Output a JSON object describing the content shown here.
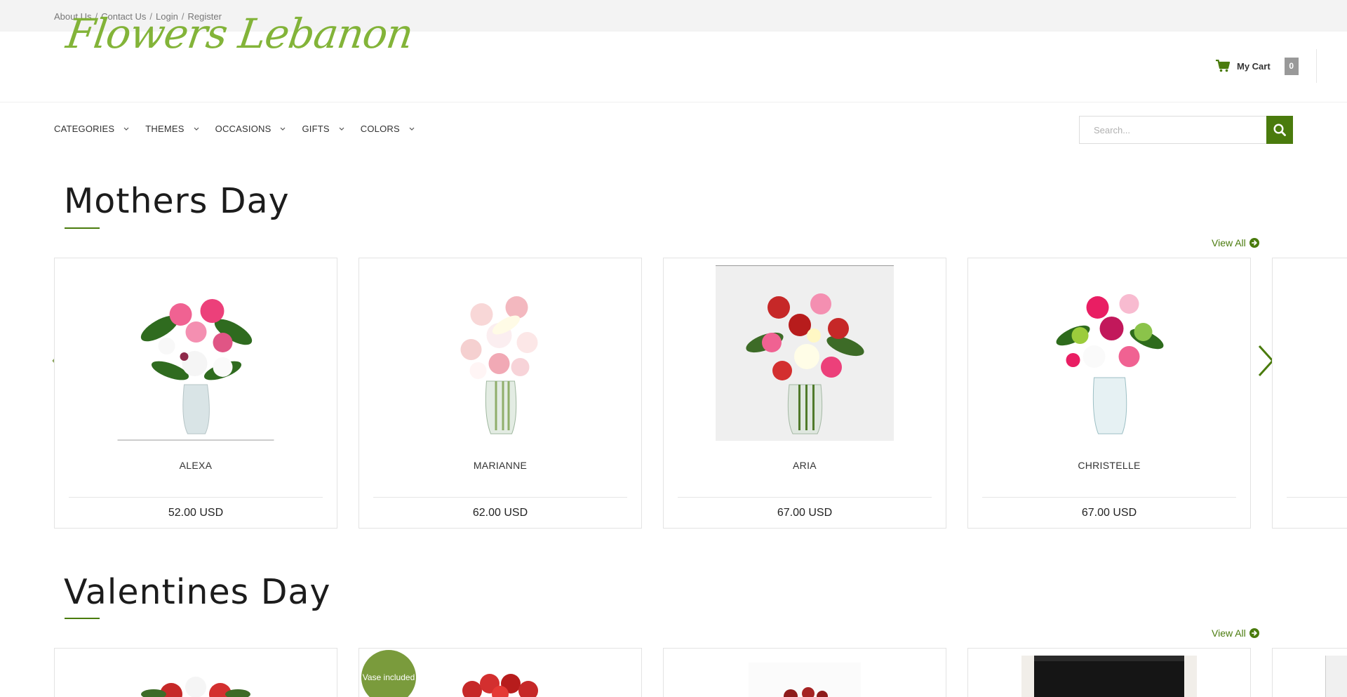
{
  "topbar": {
    "links": [
      "About Us",
      "Contact Us",
      "Login",
      "Register"
    ],
    "separator": "/"
  },
  "brand": {
    "logo_text": "Flowers Lebanon",
    "accent": "#7db02f"
  },
  "cart": {
    "label": "My Cart",
    "count": "0",
    "icon": "shopping-cart-icon"
  },
  "nav": {
    "items": [
      "CATEGORIES",
      "THEMES",
      "OCCASIONS",
      "GIFTS",
      "COLORS"
    ]
  },
  "search": {
    "placeholder": "Search...",
    "button_icon": "search-icon",
    "button_color": "#4a7b0d"
  },
  "sections": [
    {
      "title": "Mothers Day",
      "view_all": "View All",
      "products": [
        {
          "name": "ALEXA",
          "price": "52.00 USD"
        },
        {
          "name": "MARIANNE",
          "price": "62.00 USD"
        },
        {
          "name": "ARIA",
          "price": "67.00 USD"
        },
        {
          "name": "CHRISTELLE",
          "price": "67.00 USD"
        }
      ]
    },
    {
      "title": "Valentines Day",
      "view_all": "View All",
      "badge": "Vase included"
    }
  ]
}
